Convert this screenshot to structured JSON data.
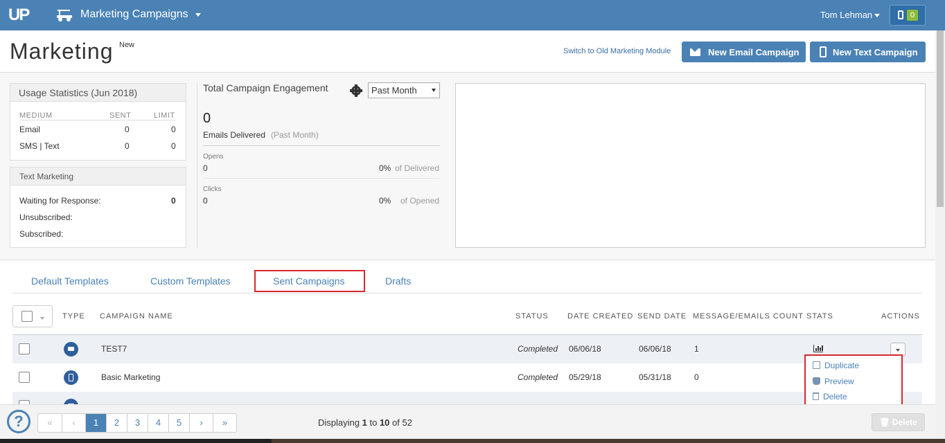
{
  "topbar": {
    "logo": "UP",
    "app_title": "Marketing Campaigns",
    "user_name": "Tom Lehman",
    "notification_count": "0"
  },
  "header": {
    "title": "Marketing",
    "title_sup": "New",
    "switch_link": "Switch to Old Marketing Module",
    "new_email_label": "New Email Campaign",
    "new_text_label": "New Text Campaign"
  },
  "usage": {
    "title": "Usage Statistics (Jun 2018)",
    "columns": [
      "MEDIUM",
      "SENT",
      "LIMIT"
    ],
    "rows": [
      {
        "medium": "Email",
        "sent": "0",
        "limit": "0"
      },
      {
        "medium": "SMS | Text",
        "sent": "0",
        "limit": "0"
      }
    ]
  },
  "text_marketing": {
    "title": "Text Marketing",
    "rows": [
      {
        "label": "Waiting for Response:",
        "value": "0"
      },
      {
        "label": "Unsubscribed:",
        "value": ""
      },
      {
        "label": "Subscribed:",
        "value": ""
      }
    ]
  },
  "engagement": {
    "title": "Total Campaign Engagement",
    "period": "Past Month",
    "delivered_count": "0",
    "delivered_label": "Emails Delivered",
    "delivered_note": "(Past Month)",
    "opens_label": "Opens",
    "opens_value": "0",
    "opens_pct": "0%",
    "opens_pct_note": "of Delivered",
    "clicks_label": "Clicks",
    "clicks_value": "0",
    "clicks_pct": "0%",
    "clicks_pct_note": "of Opened"
  },
  "tabs": [
    {
      "label": "Default Templates"
    },
    {
      "label": "Custom Templates"
    },
    {
      "label": "Sent Campaigns",
      "active": true
    },
    {
      "label": "Drafts"
    }
  ],
  "table": {
    "columns": [
      "TYPE",
      "CAMPAIGN NAME",
      "STATUS",
      "DATE CREATED",
      "SEND DATE",
      "MESSAGE/EMAILS COUNT",
      "STATS",
      "ACTIONS"
    ],
    "rows": [
      {
        "type": "email",
        "name": "TEST7",
        "status": "Completed",
        "created": "06/06/18",
        "sent": "06/06/18",
        "count": "1"
      },
      {
        "type": "text",
        "name": "Basic Marketing",
        "status": "Completed",
        "created": "05/29/18",
        "sent": "05/31/18",
        "count": "0"
      }
    ]
  },
  "actions_menu": {
    "items": [
      "Duplicate",
      "Preview",
      "Delete"
    ]
  },
  "footer": {
    "pager": [
      "«",
      "‹",
      "1",
      "2",
      "3",
      "4",
      "5",
      "›",
      "»"
    ],
    "display_prefix": "Displaying",
    "display_from": "1",
    "display_to_word": "to",
    "display_to": "10",
    "display_of_word": "of",
    "display_total": "52",
    "delete_label": "Delete"
  },
  "colors": {
    "brand": "#4a82b5",
    "highlight": "#d9272e",
    "badge": "#8bbd3c"
  }
}
